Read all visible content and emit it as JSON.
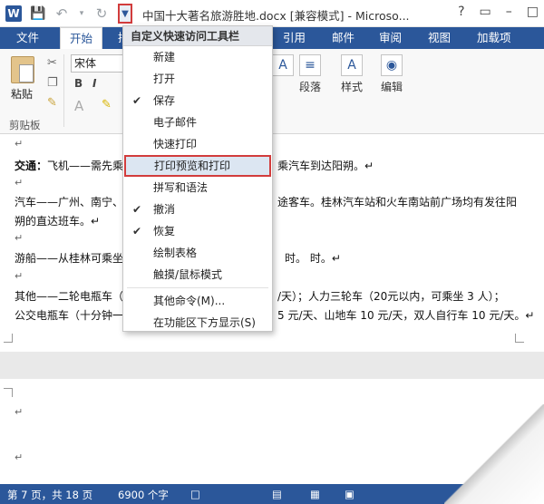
{
  "titlebar": {
    "word_icon": "W",
    "document_title": "中国十大著名旅游胜地.docx [兼容模式] - Microso...",
    "controls": [
      "?",
      "▭",
      "–",
      "□"
    ]
  },
  "tabs": {
    "file": "文件",
    "home": "开始",
    "partial": "插",
    "references": "引用",
    "mailings": "邮件",
    "review": "审阅",
    "view": "视图",
    "addins": "加载项"
  },
  "ribbon": {
    "paste_label": "粘贴",
    "clipboard_group": "剪贴板",
    "font_name": "宋体",
    "bold": "B",
    "italic": "I",
    "paragraph_label": "段落",
    "styles_label": "样式",
    "editing_label": "编辑"
  },
  "menu": {
    "header": "自定义快速访问工具栏",
    "items": [
      {
        "label": "新建",
        "checked": false
      },
      {
        "label": "打开",
        "checked": false
      },
      {
        "label": "保存",
        "checked": true
      },
      {
        "label": "电子邮件",
        "checked": false
      },
      {
        "label": "快速打印",
        "checked": false
      },
      {
        "label": "打印预览和打印",
        "checked": false
      },
      {
        "label": "拼写和语法",
        "checked": false
      },
      {
        "label": "撤消",
        "checked": true
      },
      {
        "label": "恢复",
        "checked": true
      },
      {
        "label": "绘制表格",
        "checked": false
      },
      {
        "label": "触摸/鼠标模式",
        "checked": false
      }
    ],
    "more_commands": "其他命令(M)...",
    "show_below": "在功能区下方显示(S)"
  },
  "document": {
    "mark": "↵",
    "p1_bold": "交通：",
    "p1_left": "飞机——需先乘",
    "p1_right": "乘汽车到达阳朔。↵",
    "p2_left": "汽车——广州、南宁、",
    "p2_right": "途客车。桂林汽车站和火车南站前广场均有发往阳",
    "p2_line2": "朔的直达班车。↵",
    "p3_left": "游船——从桂林可乘坐",
    "p3_right": "时。  时。↵",
    "p4_left": "其他——二轮电瓶车（",
    "p4_right": "/天）；人力三轮车（20元以内，可乘坐 3 人）；",
    "p5_left": "公交电瓶车（十分钟一",
    "p5_right": "5 元/天、山地车 10 元/天，双人自行车 10 元/天。↵"
  },
  "statusbar": {
    "page": "第 7 页，共 18 页",
    "words": "6900 个字"
  }
}
